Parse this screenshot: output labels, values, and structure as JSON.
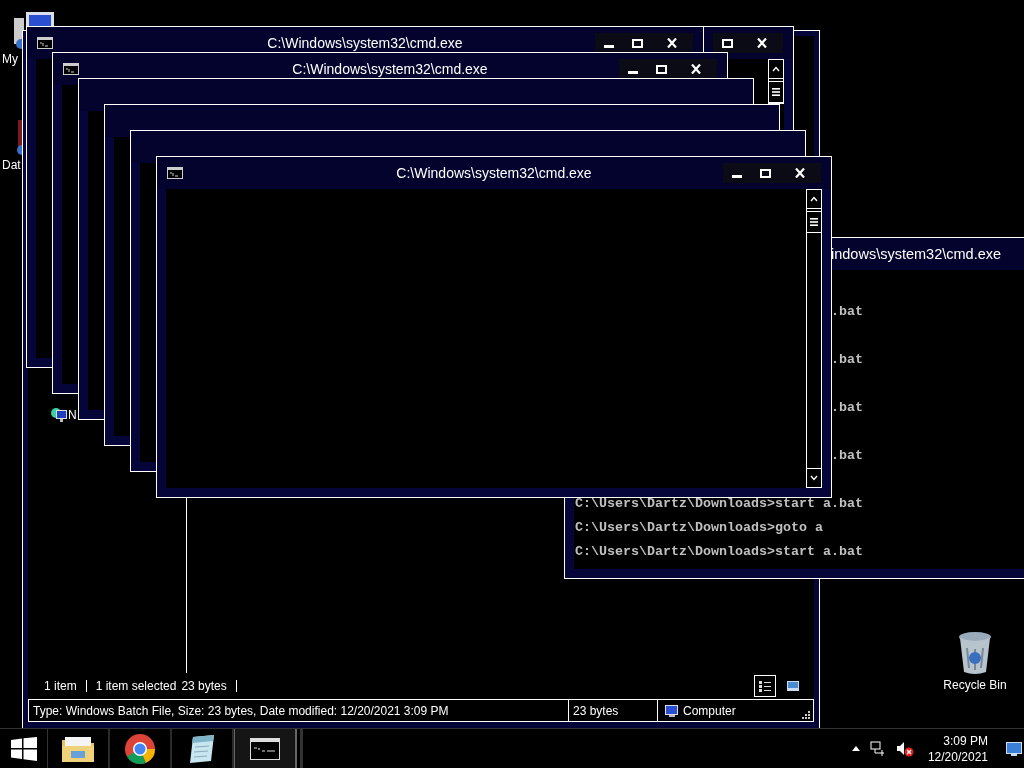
{
  "desktop_icons": [
    {
      "kind": "computer",
      "label": "My"
    },
    {
      "kind": "document",
      "label": "Dat"
    },
    {
      "kind": "recycle",
      "label": "Recycle Bin"
    }
  ],
  "explorer": {
    "nav_items": [
      {
        "label": "N"
      }
    ],
    "status": {
      "count": "1 item",
      "selected": "1 item selected",
      "size": "23 bytes"
    },
    "views": [
      {
        "kind": "details",
        "selected": true
      },
      {
        "kind": "preview",
        "selected": false
      }
    ],
    "details_bar": {
      "description": "Type: Windows Batch File, Size: 23 bytes, Date modified: 12/20/2021 3:09 PM",
      "size": "23 bytes",
      "zone": "Computer"
    }
  },
  "windows": [
    {
      "kind": "console",
      "controls": [
        {
          "kind": "maximize"
        },
        {
          "kind": "close"
        }
      ]
    },
    {
      "kind": "bare",
      "title": "C:\\Windows\\system32\\cmd.exe",
      "controls": [
        {
          "kind": "minimize"
        },
        {
          "kind": "maximize"
        },
        {
          "kind": "close"
        }
      ]
    },
    {
      "kind": "bare",
      "title": "C:\\Windows\\system32\\cmd.exe",
      "controls": [
        {
          "kind": "minimize"
        },
        {
          "kind": "maximize"
        },
        {
          "kind": "close"
        }
      ]
    },
    {
      "kind": "blank"
    },
    {
      "kind": "frame"
    },
    {
      "kind": "frame"
    },
    {
      "kind": "bare",
      "title": "indows\\system32\\cmd.exe",
      "lines": [
        {
          "kind": "partial",
          "text": ".bat"
        },
        {
          "kind": "partial",
          "text": ".bat"
        },
        {
          "kind": "partial",
          "text": ".bat"
        },
        {
          "kind": "partial",
          "text": ".bat"
        },
        {
          "kind": "full",
          "text": "C:\\Users\\Dartz\\Downloads>start a.bat"
        },
        {
          "kind": "full",
          "text": "C:\\Users\\Dartz\\Downloads>goto a"
        },
        {
          "kind": "full",
          "text": "C:\\Users\\Dartz\\Downloads>start a.bat"
        }
      ]
    },
    {
      "kind": "console",
      "title": "C:\\Windows\\system32\\cmd.exe",
      "controls": [
        {
          "kind": "minimize"
        },
        {
          "kind": "maximize"
        },
        {
          "kind": "close"
        }
      ]
    }
  ],
  "taskbar": {
    "apps": [
      {
        "kind": "folder",
        "selected": false
      },
      {
        "kind": "browser",
        "selected": false
      },
      {
        "kind": "notepad",
        "selected": false
      },
      {
        "kind": "console",
        "selected": true
      }
    ],
    "clock": {
      "time": "3:09 PM",
      "date": "12/20/2021"
    }
  }
}
